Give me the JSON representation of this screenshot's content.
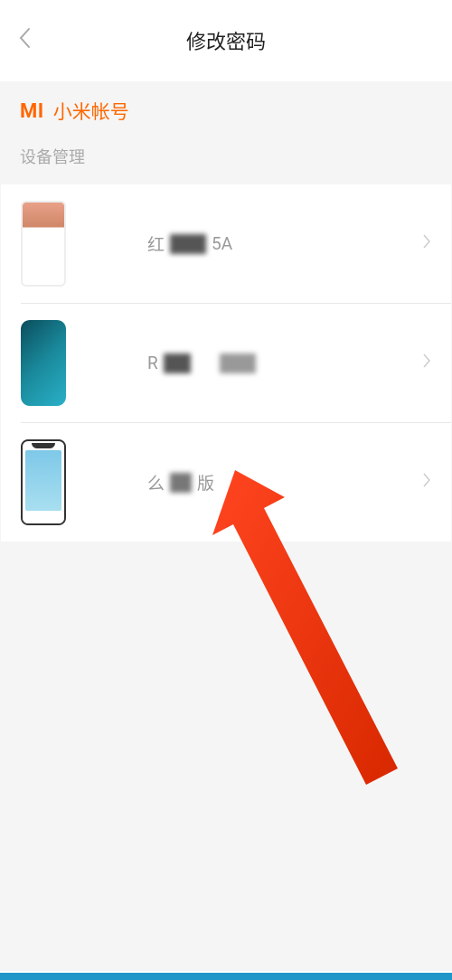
{
  "header": {
    "title": "修改密码"
  },
  "brand": {
    "logo": "MI",
    "text": "小米帐号"
  },
  "section": {
    "label": "设备管理"
  },
  "devices": [
    {
      "prefix": "红",
      "suffix": "5A"
    },
    {
      "prefix": "R",
      "suffix": ""
    },
    {
      "prefix": "么",
      "suffix": "版"
    }
  ]
}
